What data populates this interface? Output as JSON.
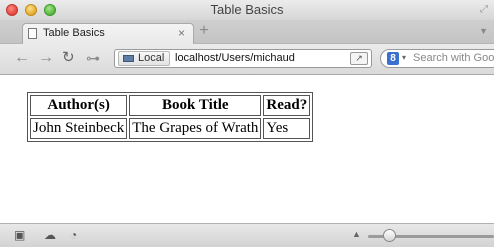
{
  "window": {
    "title": "Table Basics"
  },
  "tab": {
    "title": "Table Basics",
    "close_glyph": "×",
    "new_tab_glyph": "+"
  },
  "nav": {
    "back_glyph": "←",
    "forward_glyph": "→",
    "reload_glyph": "↻",
    "key_glyph": "⊶"
  },
  "urlbar": {
    "badge_label": "Local",
    "url": "localhost/Users/michaud",
    "share_glyph": "↗"
  },
  "searchbar": {
    "engine_glyph": "8",
    "dropdown_glyph": "▾",
    "placeholder": "Search with Google"
  },
  "table": {
    "headers": [
      "Author(s)",
      "Book Title",
      "Read?"
    ],
    "rows": [
      [
        "John Steinbeck",
        "The Grapes of Wrath",
        "Yes"
      ]
    ]
  },
  "statusbar": {
    "panel_glyph": "▣",
    "cloud_glyph": "☁",
    "gauge_glyph": "◔",
    "zoom_minus_glyph": "▲"
  },
  "icons": {
    "close": "red-traffic-light",
    "minimize": "yellow-traffic-light",
    "maximize": "green-traffic-light"
  }
}
